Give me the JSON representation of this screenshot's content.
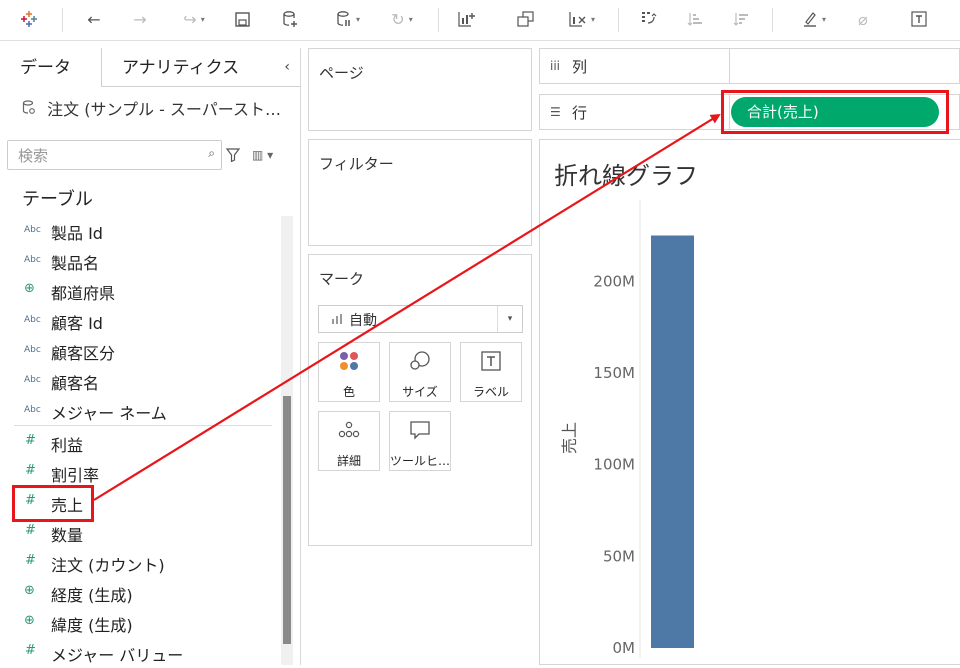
{
  "tabs": {
    "data": "データ",
    "analytics": "アナリティクス"
  },
  "datasource": {
    "name": "注文 (サンプル - スーパーストア)"
  },
  "search": {
    "placeholder": "検索"
  },
  "table_header": "テーブル",
  "fields": [
    {
      "type": "abc",
      "name": "製品 Id"
    },
    {
      "type": "abc",
      "name": "製品名"
    },
    {
      "type": "geo",
      "name": "都道府県"
    },
    {
      "type": "abc",
      "name": "顧客 Id"
    },
    {
      "type": "abc",
      "name": "顧客区分"
    },
    {
      "type": "abc",
      "name": "顧客名"
    },
    {
      "type": "abc",
      "name": "メジャー ネーム"
    },
    {
      "type": "num",
      "name": "利益"
    },
    {
      "type": "num",
      "name": "割引率"
    },
    {
      "type": "num",
      "name": "売上"
    },
    {
      "type": "num",
      "name": "数量"
    },
    {
      "type": "num",
      "name": "注文 (カウント)"
    },
    {
      "type": "geo",
      "name": "経度 (生成)"
    },
    {
      "type": "geo",
      "name": "緯度 (生成)"
    },
    {
      "type": "num",
      "name": "メジャー バリュー"
    }
  ],
  "cards": {
    "pages": "ページ",
    "filters": "フィルター",
    "marks": "マーク"
  },
  "marks": {
    "type_selected": "自動",
    "buttons": {
      "color": "色",
      "size": "サイズ",
      "label": "ラベル",
      "detail": "詳細",
      "tooltip": "ツールヒ…"
    }
  },
  "shelves": {
    "columns": "列",
    "rows": "行"
  },
  "rows_pill": "合計(売上)",
  "sheet_title": "折れ線グラフ",
  "colors": {
    "pill": "#00a86b",
    "bar": "#4e79a7",
    "annotation": "#e8161a"
  },
  "chart_data": {
    "type": "bar",
    "title": "折れ線グラフ",
    "ylabel": "売上",
    "ylim": [
      0,
      240000000
    ],
    "yticks": [
      {
        "value": 0,
        "label": "0M"
      },
      {
        "value": 50000000,
        "label": "50M"
      },
      {
        "value": 100000000,
        "label": "100M"
      },
      {
        "value": 150000000,
        "label": "150M"
      },
      {
        "value": 200000000,
        "label": "200M"
      }
    ],
    "values": [
      225000000
    ]
  }
}
